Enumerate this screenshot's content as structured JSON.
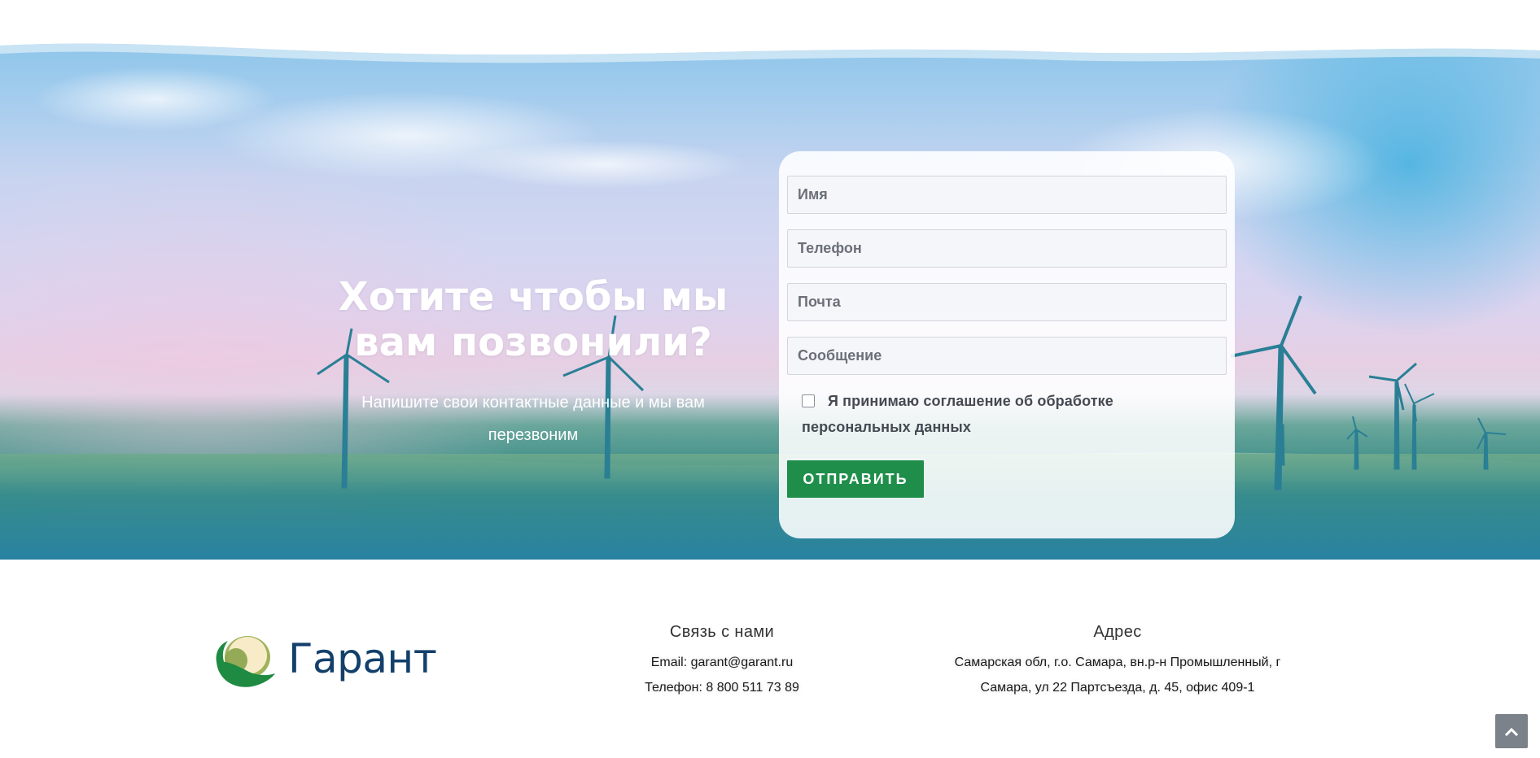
{
  "hero": {
    "title_line1": "Хотите чтобы мы",
    "title_line2": "вам позвонили?",
    "subtitle": "Напишите свои контактные данные и мы вам перезвоним"
  },
  "form": {
    "name_placeholder": "Имя",
    "phone_placeholder": "Телефон",
    "email_placeholder": "Почта",
    "message_placeholder": "Сообщение",
    "consent_label": "Я принимаю соглашение об обработке персональных данных",
    "consent_checked": false,
    "submit_label": "ОТПРАВИТЬ"
  },
  "footer": {
    "logo_text": "Гарант",
    "contacts": {
      "title": "Связь с нами",
      "email_line": "Email: garant@garant.ru",
      "phone_line": "Телефон: 8 800 511 73 89"
    },
    "address": {
      "title": "Адрес",
      "line1": "Самарская обл, г.о. Самара, вн.р-н Промышленный, г",
      "line2": "Самара, ул 22 Партсъезда, д. 45, офис 409-1"
    }
  },
  "colors": {
    "submit_bg": "#1f8e4b",
    "logo_text": "#13406b",
    "scroll_top_bg": "#7c8289"
  },
  "icons": {
    "scroll_top": "chevron-up-icon",
    "logo": "garant-logo-icon"
  }
}
